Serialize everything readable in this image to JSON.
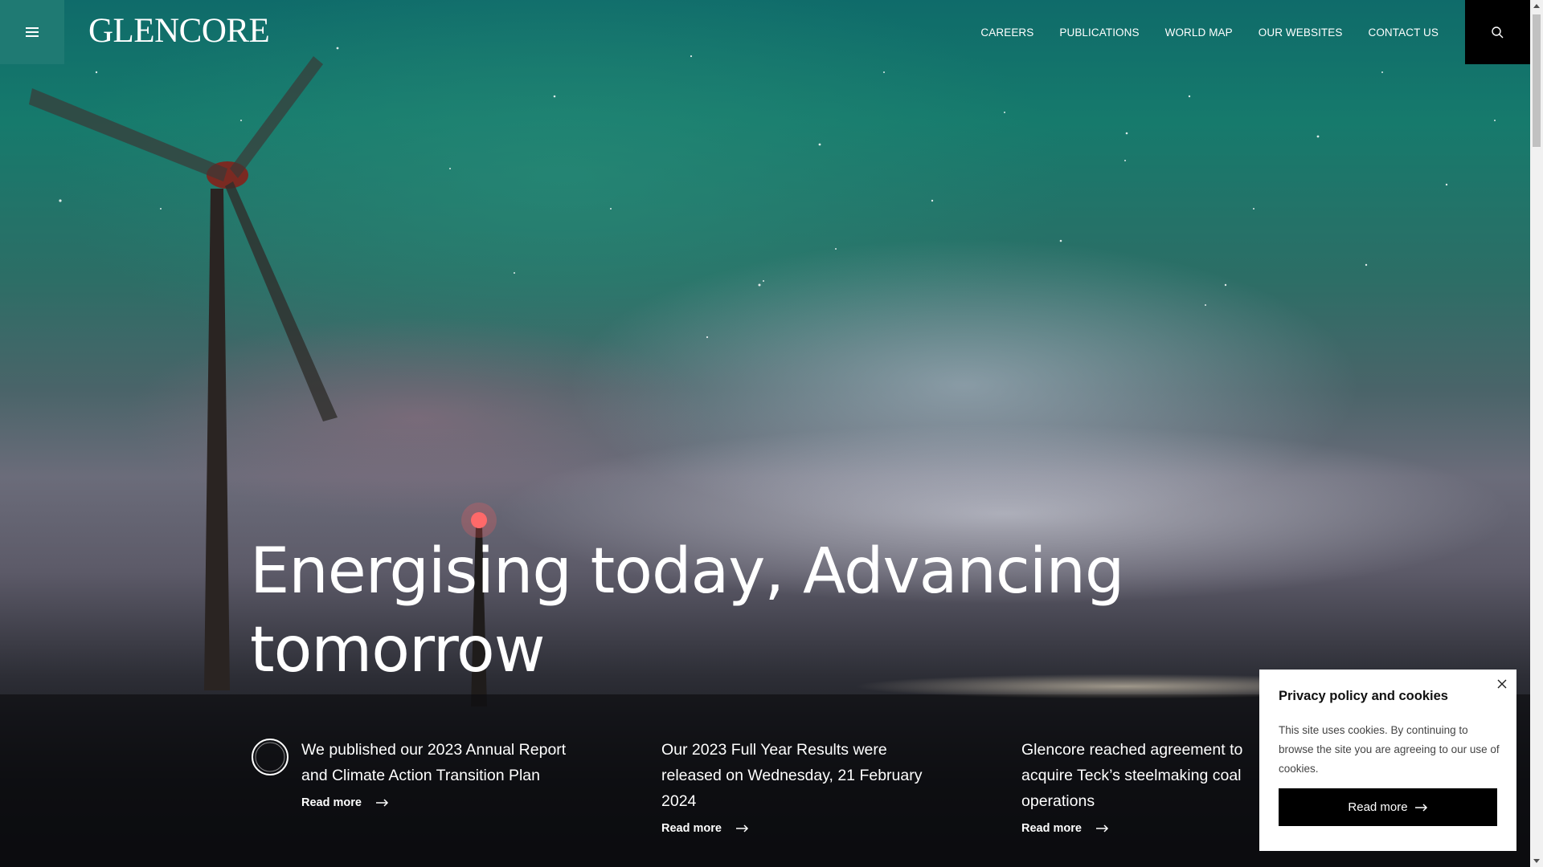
{
  "header": {
    "menu_icon": "hamburger-icon",
    "logo_text": "GLENCORE",
    "nav": [
      "CAREERS",
      "PUBLICATIONS",
      "WORLD MAP",
      "OUR WEBSITES",
      "CONTACT US"
    ],
    "search_icon": "search-icon",
    "accent_color": "#1f7a73"
  },
  "hero": {
    "headline_line1": "Energising today, Advancing",
    "headline_line2": "tomorrow"
  },
  "news": [
    {
      "text": "We published our 2023 Annual Report and Climate Action Transition Plan",
      "link": "Read more"
    },
    {
      "text": "Our 2023 Full Year Results were released on Wednesday, 21 February 2024",
      "link": "Read more"
    },
    {
      "text": "Glencore reached agreement to acquire Teck’s steelmaking coal operations",
      "link": "Read more"
    }
  ],
  "cookie": {
    "title": "Privacy policy and cookies",
    "body": "This site uses cookies. By continuing to browse the site you are agreeing to our use of cookies.",
    "button": "Read more",
    "close_icon": "close-icon"
  }
}
